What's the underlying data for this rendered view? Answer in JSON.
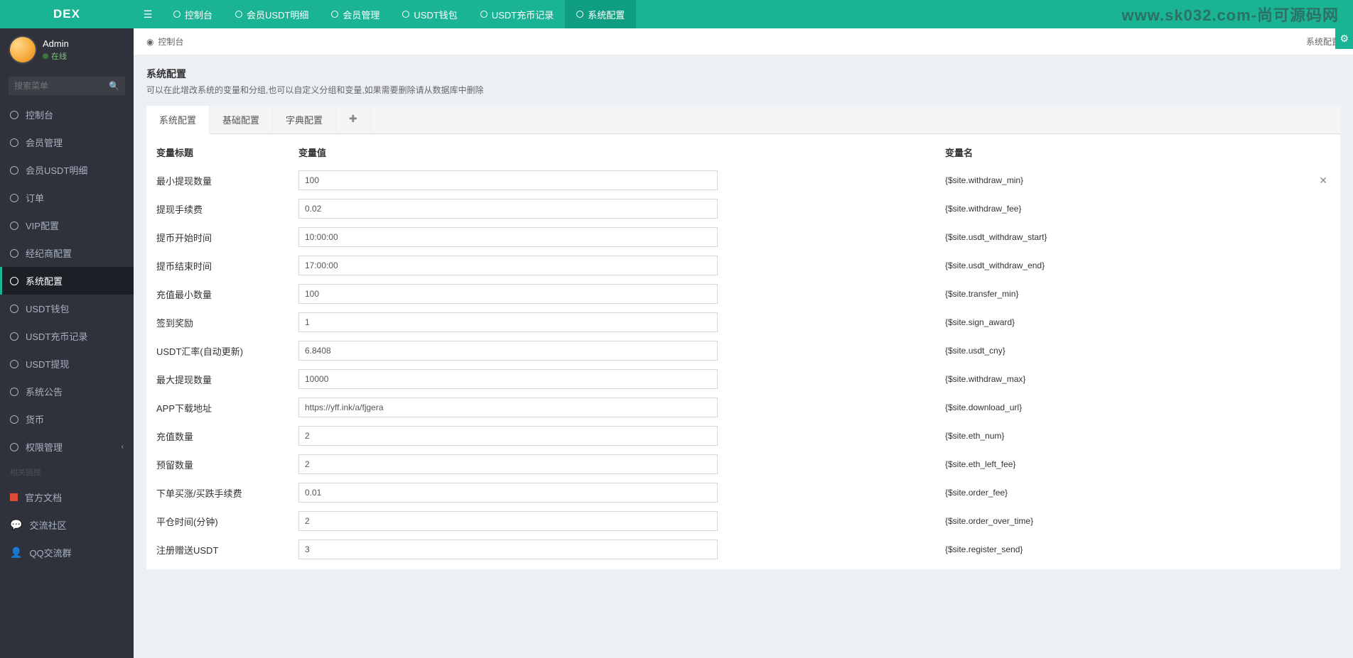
{
  "brand": "DEX",
  "watermark": "www.sk032.com-尚可源码网",
  "topnav": [
    {
      "label": "控制台"
    },
    {
      "label": "会员USDT明细"
    },
    {
      "label": "会员管理"
    },
    {
      "label": "USDT钱包"
    },
    {
      "label": "USDT充币记录"
    },
    {
      "label": "系统配置",
      "active": true
    }
  ],
  "user": {
    "name": "Admin",
    "status": "在线"
  },
  "search": {
    "placeholder": "搜索菜单"
  },
  "sidebar": {
    "items": [
      {
        "label": "控制台"
      },
      {
        "label": "会员管理"
      },
      {
        "label": "会员USDT明细"
      },
      {
        "label": "订单"
      },
      {
        "label": "VIP配置"
      },
      {
        "label": "经纪商配置"
      },
      {
        "label": "系统配置",
        "active": true
      },
      {
        "label": "USDT钱包"
      },
      {
        "label": "USDT充币记录"
      },
      {
        "label": "USDT提现"
      },
      {
        "label": "系统公告"
      },
      {
        "label": "货币"
      },
      {
        "label": "权限管理",
        "chevron": true
      }
    ],
    "links_header": "相关链接",
    "links": [
      {
        "label": "官方文档",
        "icon": "doc"
      },
      {
        "label": "交流社区",
        "icon": "chat"
      },
      {
        "label": "QQ交流群",
        "icon": "qq"
      }
    ]
  },
  "breadcrumb": {
    "home": "控制台",
    "current": "系统配置"
  },
  "panel": {
    "title": "系统配置",
    "desc": "可以在此增改系统的变量和分组,也可以自定义分组和变量,如果需要删除请从数据库中删除"
  },
  "tabs": [
    {
      "label": "系统配置",
      "active": true
    },
    {
      "label": "基础配置"
    },
    {
      "label": "字典配置"
    }
  ],
  "columns": {
    "label": "变量标题",
    "value": "变量值",
    "var": "变量名"
  },
  "rows": [
    {
      "label": "最小提现数量",
      "value": "100",
      "var": "{$site.withdraw_min}",
      "closable": true
    },
    {
      "label": "提现手续费",
      "value": "0.02",
      "var": "{$site.withdraw_fee}"
    },
    {
      "label": "提币开始时间",
      "value": "10:00:00",
      "var": "{$site.usdt_withdraw_start}"
    },
    {
      "label": "提币结束时间",
      "value": "17:00:00",
      "var": "{$site.usdt_withdraw_end}"
    },
    {
      "label": "充值最小数量",
      "value": "100",
      "var": "{$site.transfer_min}"
    },
    {
      "label": "签到奖励",
      "value": "1",
      "var": "{$site.sign_award}"
    },
    {
      "label": "USDT汇率(自动更新)",
      "value": "6.8408",
      "var": "{$site.usdt_cny}"
    },
    {
      "label": "最大提现数量",
      "value": "10000",
      "var": "{$site.withdraw_max}"
    },
    {
      "label": "APP下载地址",
      "value": "https://yff.ink/a/fjgera",
      "var": "{$site.download_url}"
    },
    {
      "label": "充值数量",
      "value": "2",
      "var": "{$site.eth_num}"
    },
    {
      "label": "预留数量",
      "value": "2",
      "var": "{$site.eth_left_fee}"
    },
    {
      "label": "下单买涨/买跌手续费",
      "value": "0.01",
      "var": "{$site.order_fee}"
    },
    {
      "label": "平仓时间(分钟)",
      "value": "2",
      "var": "{$site.order_over_time}"
    },
    {
      "label": "注册赠送USDT",
      "value": "3",
      "var": "{$site.register_send}"
    }
  ]
}
